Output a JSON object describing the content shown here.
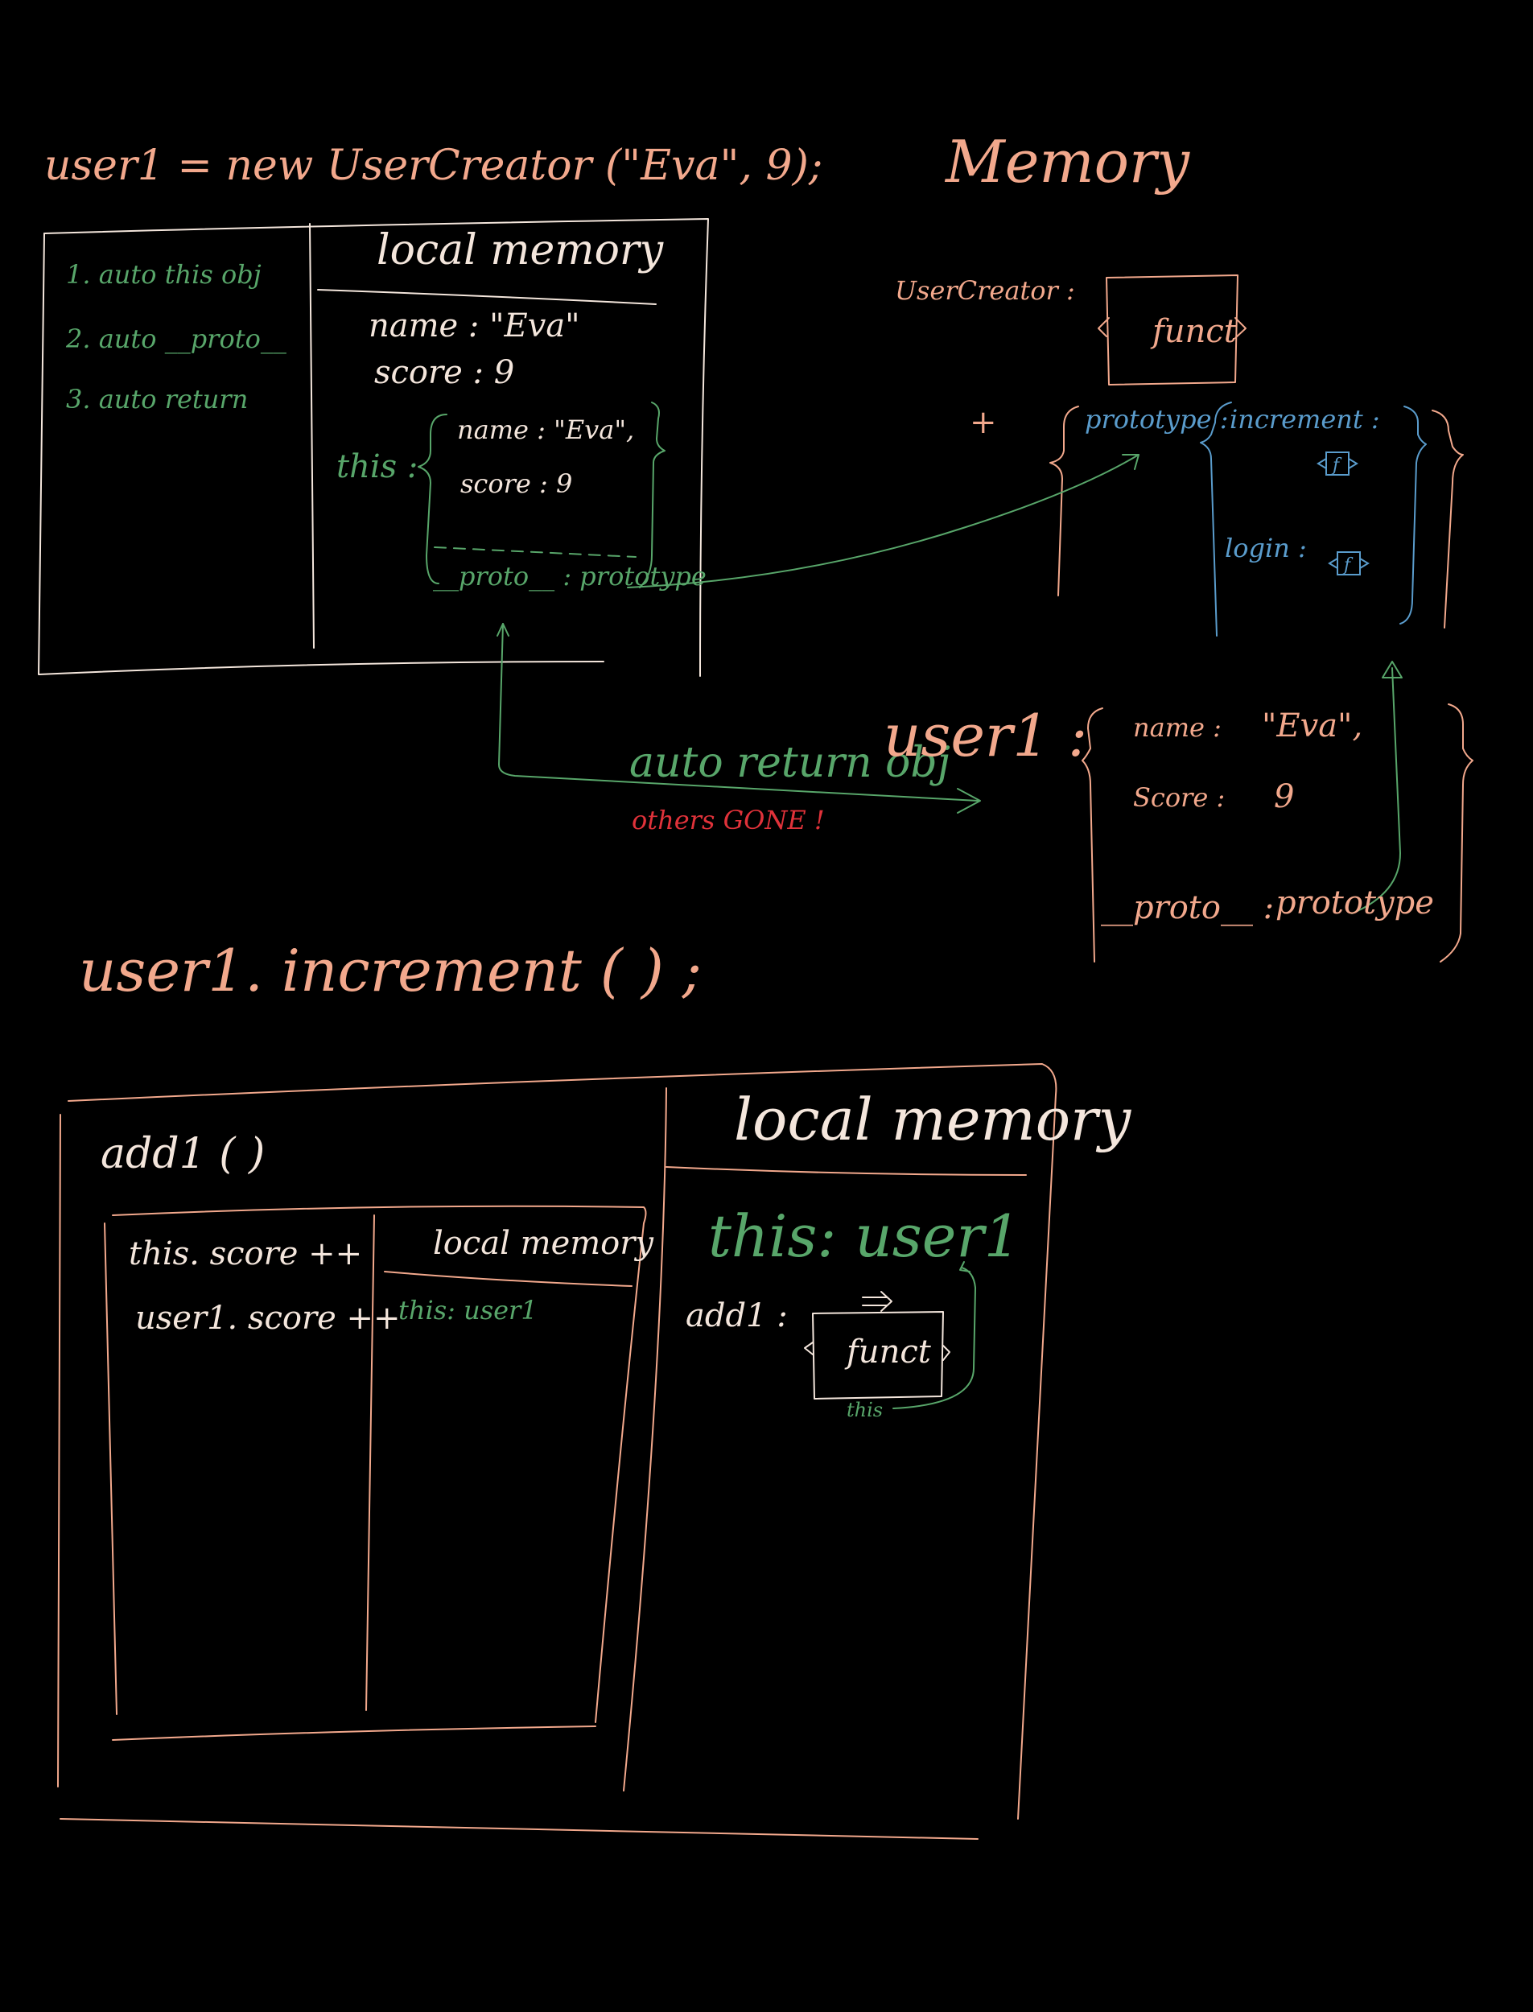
{
  "statement1": "user1 = new UserCreator (\"Eva\", 9);",
  "memory_title": "Memory",
  "creator": {
    "steps": [
      "1. auto this obj",
      "2. auto __proto__",
      "3. auto return"
    ],
    "local_memory_title": "local memory",
    "name_entry": "name : \"Eva\"",
    "score_entry": "score : 9",
    "this_label": "this :",
    "this_name": "name : \"Eva\",",
    "this_score": "score : 9",
    "this_proto": "__proto__ : prototype"
  },
  "heap": {
    "creator_label": "UserCreator :",
    "funct_label": "funct",
    "plus": "+",
    "prototype_label": "prototype :",
    "increment_label": "increment :",
    "login_label": "login :",
    "f_icon": "f"
  },
  "return_note": {
    "auto_return": "auto return obj",
    "others_gone": "others GONE !"
  },
  "user1_obj": {
    "label": "user1 :",
    "name": "name :",
    "name_val": "\"Eva\",",
    "score": "Score :",
    "score_val": "9",
    "proto": "__proto__ :",
    "proto_val": "prototype"
  },
  "statement2": "user1. increment (   ) ;",
  "increment_frame": {
    "add1_call": "add1 (  )",
    "line1": "this. score ++",
    "line2": "user1. score ++",
    "inner_local_memory": "local memory",
    "inner_this": "this: user1",
    "outer_local_memory": "local memory",
    "outer_this": "this: user1",
    "add1_label": "add1 :",
    "funct_label": "funct",
    "this_arrow_label": "this"
  },
  "colors": {
    "salmon": "#f2a88c",
    "cream": "#f4e6dc",
    "green": "#58a66a",
    "blue": "#5a9ccc",
    "red": "#e0323a"
  }
}
